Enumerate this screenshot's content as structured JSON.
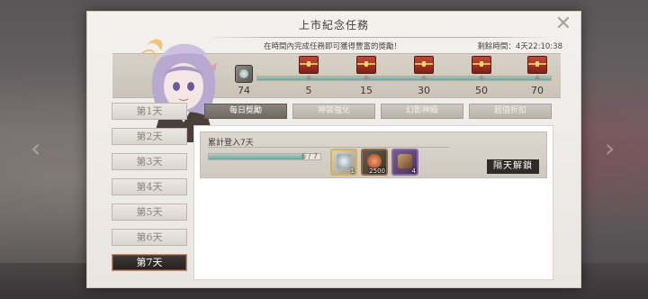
{
  "dialog": {
    "title": "上市紀念任務",
    "subtitle": "在時間內完成任務即可獲得豐富的獎勵！",
    "remaining_time": "剩餘時間：4天22:10:38",
    "close_label": "✕"
  },
  "progress": {
    "points": "74",
    "max_points": 70,
    "fill_fraction": 1.0,
    "milestones": [
      {
        "value": "5"
      },
      {
        "value": "15"
      },
      {
        "value": "30"
      },
      {
        "value": "50"
      },
      {
        "value": "70"
      }
    ]
  },
  "days": [
    {
      "label": "第1天"
    },
    {
      "label": "第2天"
    },
    {
      "label": "第3天"
    },
    {
      "label": "第4天"
    },
    {
      "label": "第5天"
    },
    {
      "label": "第6天"
    },
    {
      "label": "第7天",
      "active": true
    }
  ],
  "tabs": [
    {
      "label": "每日獎勵",
      "active": true
    },
    {
      "label": "神裝強化"
    },
    {
      "label": "幻影神殿"
    },
    {
      "label": "超值折扣"
    }
  ],
  "task": {
    "name": "累計登入7天",
    "progress_text": "6 / 7",
    "progress_fraction": 0.857,
    "rewards": [
      {
        "icon": "gear-item-icon",
        "count": "1",
        "style": "gold"
      },
      {
        "icon": "orb-item-icon",
        "count": "2500",
        "style": "brown"
      },
      {
        "icon": "chest-item-icon",
        "count": "4",
        "style": "purple"
      }
    ],
    "button_label": "隔天解鎖"
  },
  "colors": {
    "accent_teal": "#6fa39b",
    "chest_red": "#b03e2c",
    "active_tab": "#7a746c"
  }
}
